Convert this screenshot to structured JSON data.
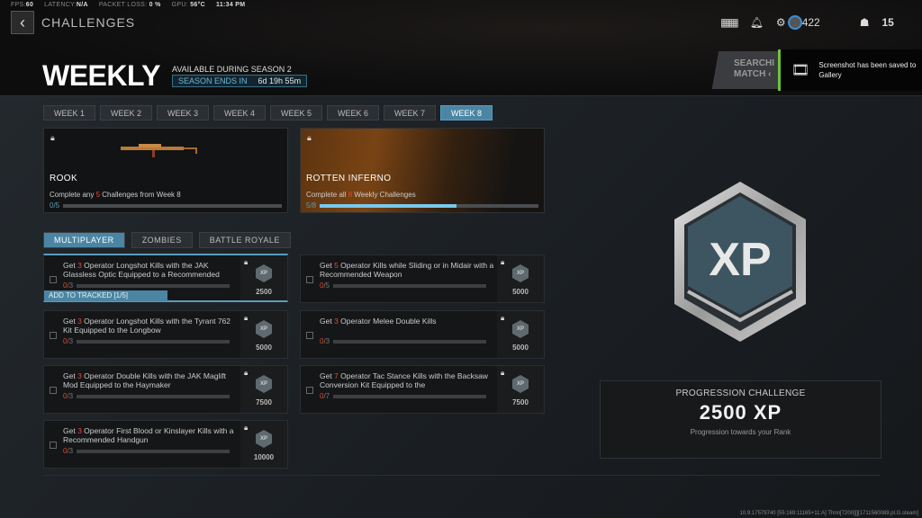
{
  "status": {
    "fps_label": "FPS:",
    "fps": "60",
    "latency_label": "LATENCY:",
    "latency": "N/A",
    "loss_label": "PACKET LOSS:",
    "loss": "0 %",
    "gpu_label": "GPU:",
    "gpu": "56°C",
    "time": "11:34 PM"
  },
  "header": {
    "breadcrumb": "CHALLENGES",
    "title": "WEEKLY",
    "available": "AVAILABLE DURING SEASON 2",
    "ends_label": "SEASON ENDS IN",
    "ends_value": "6d 19h 55m",
    "currency": "422",
    "players": "15"
  },
  "search": {
    "line1": "SEARCHI",
    "line2": "MATCH ‹"
  },
  "notification": {
    "text": "Screenshot has been saved to Gallery"
  },
  "weeks": [
    {
      "label": "WEEK 1"
    },
    {
      "label": "WEEK 2"
    },
    {
      "label": "WEEK 3"
    },
    {
      "label": "WEEK 4"
    },
    {
      "label": "WEEK 5"
    },
    {
      "label": "WEEK 6"
    },
    {
      "label": "WEEK 7"
    },
    {
      "label": "WEEK 8",
      "active": true
    }
  ],
  "rewards": [
    {
      "name": "ROOK",
      "pre": "Complete any ",
      "count": "5",
      "post": " Challenges from Week 8",
      "progress": "0/5",
      "fraction": 0
    },
    {
      "name": "ROTTEN INFERNO",
      "pre": "Complete all ",
      "count": "8",
      "post": " Weekly Challenges",
      "progress": "5/8",
      "fraction": 0.625
    }
  ],
  "modes": [
    {
      "label": "MULTIPLAYER",
      "active": true
    },
    {
      "label": "ZOMBIES"
    },
    {
      "label": "BATTLE ROYALE"
    }
  ],
  "challenges": [
    {
      "pre": "Get ",
      "count": "3",
      "post": " Operator Longshot Kills with the JAK Glassless Optic Equipped to a Recommended",
      "done": "0",
      "total": "/3",
      "xp": "2500",
      "tracked": "ADD TO TRACKED [1/5]"
    },
    {
      "pre": "Get ",
      "count": "3",
      "post": " Operator Longshot Kills with the Tyrant 762 Kit Equipped to the Longbow",
      "done": "0",
      "total": "/3",
      "xp": "5000"
    },
    {
      "pre": "Get ",
      "count": "3",
      "post": " Operator Double Kills with the JAK Maglift Mod Equipped to the Haymaker",
      "done": "0",
      "total": "/3",
      "xp": "7500"
    },
    {
      "pre": "Get ",
      "count": "3",
      "post": " Operator First Blood or Kinslayer Kills with a Recommended Handgun",
      "done": "0",
      "total": "/3",
      "xp": "10000"
    },
    {
      "pre": "Get ",
      "count": "5",
      "post": " Operator Kills while Sliding or in Midair with a Recommended Weapon",
      "done": "0",
      "total": "/5",
      "xp": "5000"
    },
    {
      "pre": "Get ",
      "count": "3",
      "post": " Operator Melee Double Kills",
      "done": "0",
      "total": "/3",
      "xp": "5000"
    },
    {
      "pre": "Get ",
      "count": "7",
      "post": " Operator Tac Stance Kills with the Backsaw Conversion Kit Equipped to the",
      "done": "0",
      "total": "/7",
      "xp": "7500"
    }
  ],
  "xp_badge": {
    "text": "XP",
    "mini": "XP"
  },
  "progression": {
    "title": "PROGRESSION CHALLENGE",
    "value": "2500 XP",
    "subtitle": "Progression towards your Rank"
  },
  "build": "10.9.17579740 [55:169:11165+11:A] Thnn[7200][][1711560089.pl.G.steam]",
  "colors": {
    "accent": "#4a86a3",
    "highlight": "#e04a2c",
    "progress": "#78c8ee",
    "notify": "#6cc43a"
  }
}
